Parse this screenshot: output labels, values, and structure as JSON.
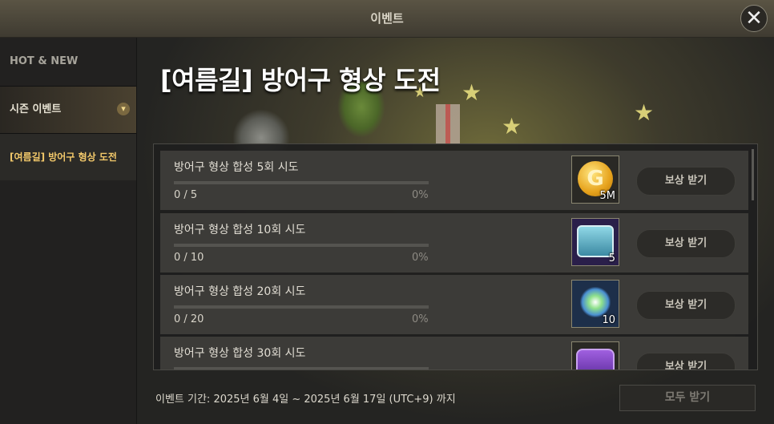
{
  "window": {
    "title": "이벤트"
  },
  "sidebar": {
    "hot_new": "HOT & NEW",
    "season": "시즌 이벤트",
    "sub_item": "[여름길] 방어구 형상 도전"
  },
  "event": {
    "title": "[여름길] 방어구 형상 도전",
    "period": "이벤트 기간: 2025년 6월 4일 ~ 2025년 6월 17일 (UTC+9) 까지",
    "claim_all_label": "모두 받기"
  },
  "missions": [
    {
      "name": "방어구 형상 합성 5회 시도",
      "progress": "0 / 5",
      "percent": "0%",
      "fraction": 0,
      "reward_icon": "gold-coin-icon",
      "reward_qty": "5M",
      "claim_label": "보상 받기"
    },
    {
      "name": "방어구 형상 합성 10회 시도",
      "progress": "0 / 10",
      "percent": "0%",
      "fraction": 0,
      "reward_icon": "treasure-chest-icon",
      "reward_qty": "5",
      "claim_label": "보상 받기"
    },
    {
      "name": "방어구 형상 합성 20회 시도",
      "progress": "0 / 20",
      "percent": "0%",
      "fraction": 0,
      "reward_icon": "gem-cluster-icon",
      "reward_qty": "10",
      "claim_label": "보상 받기"
    },
    {
      "name": "방어구 형상 합성 30회 시도",
      "progress": "",
      "percent": "",
      "fraction": 0,
      "reward_icon": "purple-chest-icon",
      "reward_qty": "",
      "claim_label": "보상 받기"
    }
  ],
  "colors": {
    "accent_gold": "#f2c86a",
    "progress_fill": "#d2b356"
  }
}
